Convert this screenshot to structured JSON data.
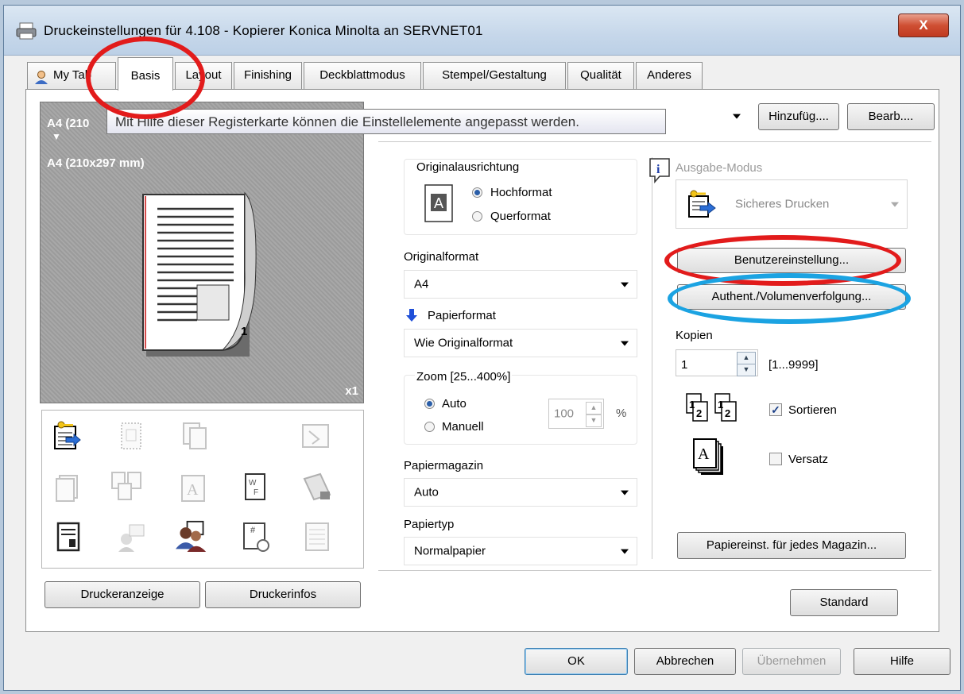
{
  "window": {
    "title": "Druckeinstellungen für 4.108 - Kopierer Konica Minolta an SERVNET01",
    "close_label": "X"
  },
  "tabs": [
    {
      "label": "My Tab"
    },
    {
      "label": "Basis",
      "active": true
    },
    {
      "label": "Layout"
    },
    {
      "label": "Finishing"
    },
    {
      "label": "Deckblattmodus"
    },
    {
      "label": "Stempel/Gestaltung"
    },
    {
      "label": "Qualität"
    },
    {
      "label": "Anderes"
    }
  ],
  "tooltip": "Mit Hilfe dieser Registerkarte können die Einstellelemente angepasst werden.",
  "preview": {
    "line1": "A4 (210",
    "arrow": "▼",
    "line2": "A4 (210x297 mm)",
    "multiplier": "x1",
    "page_number": "1"
  },
  "favorites": {
    "add_label": "Hinzufüg....",
    "edit_label": "Bearb...."
  },
  "left_buttons": {
    "printer_view": "Druckeranzeige",
    "printer_info": "Druckerinfos"
  },
  "orientation": {
    "label": "Originalausrichtung",
    "icon_letter": "A",
    "portrait": "Hochformat",
    "landscape": "Querformat",
    "selected": "portrait"
  },
  "original_size": {
    "label": "Originalformat",
    "value": "A4"
  },
  "paper_size": {
    "label": "Papierformat",
    "value": "Wie Originalformat"
  },
  "zoom": {
    "label": "Zoom [25...400%]",
    "auto": "Auto",
    "manual": "Manuell",
    "value": "100",
    "unit": "%",
    "selected": "auto"
  },
  "paper_tray": {
    "label": "Papiermagazin",
    "value": "Auto"
  },
  "paper_type": {
    "label": "Papiertyp",
    "value": "Normalpapier"
  },
  "output_mode": {
    "label": "Ausgabe-Modus",
    "value": "Sicheres Drucken"
  },
  "user_settings_label": "Benutzereinstellung...",
  "auth_label": "Authent./Volumenverfolgung...",
  "copies": {
    "label": "Kopien",
    "value": "1",
    "range": "[1...9999]"
  },
  "collate": {
    "label": "Sortieren",
    "checked": true,
    "icon_digits": [
      "1",
      "2",
      "1",
      "2"
    ]
  },
  "offset": {
    "label": "Versatz",
    "checked": false,
    "icon_letter": "A"
  },
  "paper_per_tray_label": "Papiereinst. für jedes Magazin...",
  "standard_label": "Standard",
  "footer": {
    "ok": "OK",
    "cancel": "Abbrechen",
    "apply": "Übernehmen",
    "help": "Hilfe"
  },
  "colors": {
    "annotation_red": "#e21b1b",
    "annotation_blue": "#1ba3e2",
    "titlebar": "#c6d7ea",
    "radio_selected": "#2a5ea8"
  }
}
